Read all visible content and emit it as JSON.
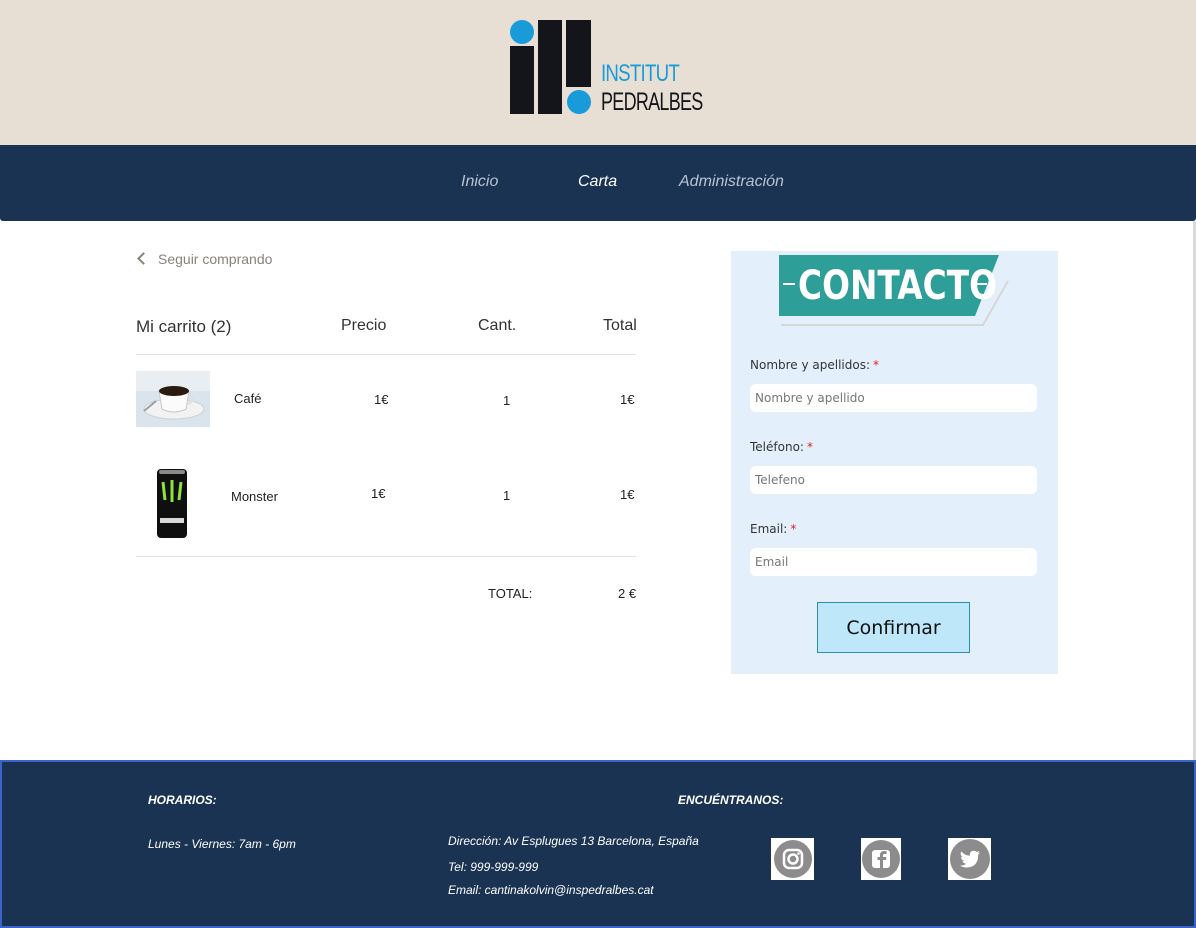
{
  "header": {
    "logo_line1": "INSTITUT",
    "logo_line2": "PEDRALBES",
    "brand_blue": "#1a9bd9"
  },
  "nav": {
    "items": [
      {
        "label": "Inicio"
      },
      {
        "label": "Carta",
        "active": true
      },
      {
        "label": "Administración"
      }
    ],
    "background": "#1b3352"
  },
  "cart": {
    "back_label": "Seguir comprando",
    "columns": {
      "title": "Mi carrito (2)",
      "price": "Precio",
      "qty": "Cant.",
      "total": "Total"
    },
    "items": [
      {
        "name": "Café",
        "price": "1€",
        "qty": "1",
        "total": "1€",
        "image": "coffee-cup"
      },
      {
        "name": "Monster",
        "price": "1€",
        "qty": "1",
        "total": "1€",
        "image": "monster-can"
      }
    ],
    "total_label": "TOTAL:",
    "total_value": "2 €"
  },
  "contact": {
    "banner": "CONTACTO",
    "banner_color": "#2e9e98",
    "name_label": "Nombre y apellidos:",
    "name_placeholder": "Nombre y apellido",
    "phone_label": "Teléfono:",
    "phone_placeholder": "Telefeno",
    "email_label": "Email:",
    "email_placeholder": "Email",
    "required_mark": "*",
    "confirm_label": "Confirmar"
  },
  "footer": {
    "hours_title": "HORARIOS:",
    "hours": "Lunes - Viernes: 7am - 6pm",
    "find_title": "ENCUÉNTRANOS:",
    "address": "Dirección: Av Esplugues 13 Barcelona, España",
    "phone": "Tel: 999-999-999",
    "email": "Email: cantinakolvin@inspedralbes.cat",
    "social": [
      "instagram-icon",
      "facebook-icon",
      "twitter-icon"
    ]
  }
}
